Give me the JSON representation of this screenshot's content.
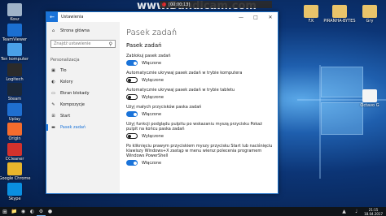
{
  "overlay": {
    "brand": "www.Bandicam.com",
    "recording": "[00:00:13]"
  },
  "desktop_icons": [
    {
      "label": "Kosz",
      "color": "#9fb3c8",
      "glyph": "bin-icon"
    },
    {
      "label": "TeamViewer",
      "color": "#1b6fd1",
      "glyph": "teamviewer-icon"
    },
    {
      "label": "Ten komputer",
      "color": "#4aa0e8",
      "glyph": "computer-icon"
    },
    {
      "label": "Logitech",
      "color": "#2b2b2b",
      "glyph": "logitech-icon"
    },
    {
      "label": "Steam",
      "color": "#1b2838",
      "glyph": "steam-icon"
    },
    {
      "label": "Uplay",
      "color": "#1f6fd0",
      "glyph": "uplay-icon"
    },
    {
      "label": "Origin",
      "color": "#f56c2d",
      "glyph": "origin-icon"
    },
    {
      "label": "CCleaner",
      "color": "#d2322d",
      "glyph": "ccleaner-icon"
    },
    {
      "label": "Google Chrome",
      "color": "#e8b52c",
      "glyph": "chrome-icon"
    },
    {
      "label": "Skype",
      "color": "#0a8fe0",
      "glyph": "skype-icon"
    }
  ],
  "desktop_icons_right": [
    {
      "label": "F.K",
      "color": "#e9c46a",
      "glyph": "folder-icon"
    },
    {
      "label": "PIRANHA-BYTES",
      "color": "#e9c46a",
      "glyph": "folder-icon"
    },
    {
      "label": "Gry",
      "color": "#e9c46a",
      "glyph": "folder-icon"
    },
    {
      "label": "Octavo G",
      "color": "#f4f4f4",
      "glyph": "document-icon"
    }
  ],
  "window": {
    "title": "Ustawienia",
    "nav": {
      "home": "Strona główna",
      "search_placeholder": "Znajdź ustawienie",
      "section": "Personalizacja",
      "items": [
        {
          "label": "Tło",
          "icon": "picture-icon"
        },
        {
          "label": "Kolory",
          "icon": "palette-icon"
        },
        {
          "label": "Ekran blokady",
          "icon": "lockscreen-icon"
        },
        {
          "label": "Kompozycje",
          "icon": "themes-icon"
        },
        {
          "label": "Start",
          "icon": "start-icon"
        },
        {
          "label": "Pasek zadań",
          "icon": "taskbar-icon"
        }
      ]
    },
    "content": {
      "title": "Pasek zadań",
      "subtitle": "Pasek zadań",
      "options": [
        {
          "label": "Zablokuj pasek zadań",
          "on": true,
          "state": "Włączone"
        },
        {
          "label": "Automatycznie ukrywaj pasek zadań w trybie komputera",
          "on": false,
          "state": "Wyłączone"
        },
        {
          "label": "Automatycznie ukrywaj pasek zadań w trybie tabletu",
          "on": false,
          "state": "Wyłączone"
        },
        {
          "label": "Użyj małych przycisków paska zadań",
          "on": true,
          "state": "Włączone"
        },
        {
          "label": "Użyj funkcji podglądu pulpitu po wskazaniu myszą przycisku Pokaż pulpit na końcu paska zadań",
          "on": false,
          "state": "Wyłączone"
        },
        {
          "label": "Po kliknięciu prawym przyciskiem myszy przycisku Start lub naciśnięciu klawiszy Windows+X zastąp w menu wiersz polecenia programem Windows PowerShell",
          "on": true,
          "state": "Włączone"
        }
      ]
    }
  },
  "taskbar": {
    "clock_time": "21:15",
    "clock_date": "18.04.2017"
  }
}
